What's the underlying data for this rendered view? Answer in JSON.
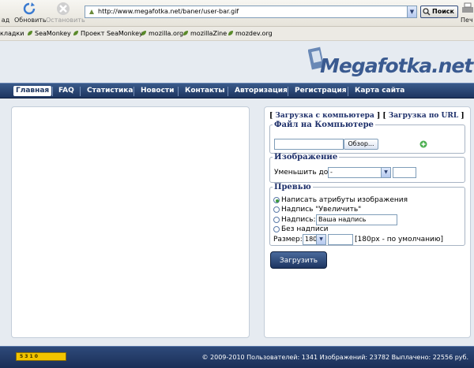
{
  "toolbar": {
    "back_label": "ад",
    "reload_label": "Обновить",
    "stop_label": "Остановить",
    "url": "http://www.megafotka.net/baner/user-bar.gif",
    "search_label": "Поиск",
    "print_label": "Печ"
  },
  "bookmarks": {
    "items": [
      "кладки",
      "SeaMonkey",
      "Проект SeaMonkey",
      "mozilla.org",
      "mozillaZine",
      "mozdev.org"
    ]
  },
  "logo": {
    "text": "Megafotka.net"
  },
  "nav": {
    "items": [
      "Главная",
      "FAQ",
      "Статистика",
      "Новости",
      "Контакты",
      "Авторизация",
      "Регистрация",
      "Карта сайта"
    ]
  },
  "upload": {
    "tab_computer": "Загрузка с компьютера",
    "tab_url": "Загрузка по URL",
    "bracket_open": "[",
    "bracket_mid": "] [",
    "bracket_close": "]",
    "file_legend": "Файл на Компьютере",
    "browse_label": "Обзор...",
    "image_legend": "Изображение",
    "reduce_label": "Уменьшить до:",
    "reduce_value": "-",
    "preview_legend": "Превью",
    "opt_attributes": "Написать атрибуты изображения",
    "opt_enlarge": "Надпись \"Увеличить\"",
    "opt_caption": "Надпись:",
    "caption_value": "Ваша надпись",
    "opt_none": "Без надписи",
    "size_label": "Размер:",
    "size_value": "180",
    "size_hint": "[180px - по умолчанию]",
    "submit_label": "Загрузить"
  },
  "footer": {
    "counter_label": "5 3 1 0",
    "stats": "© 2009-2010 Пользователей: 1341 Изображений: 23782 Выплачено: 22556 руб."
  },
  "colors": {
    "nav": "#1d3560",
    "accent": "#3a5a90",
    "counter": "#f2c400"
  }
}
